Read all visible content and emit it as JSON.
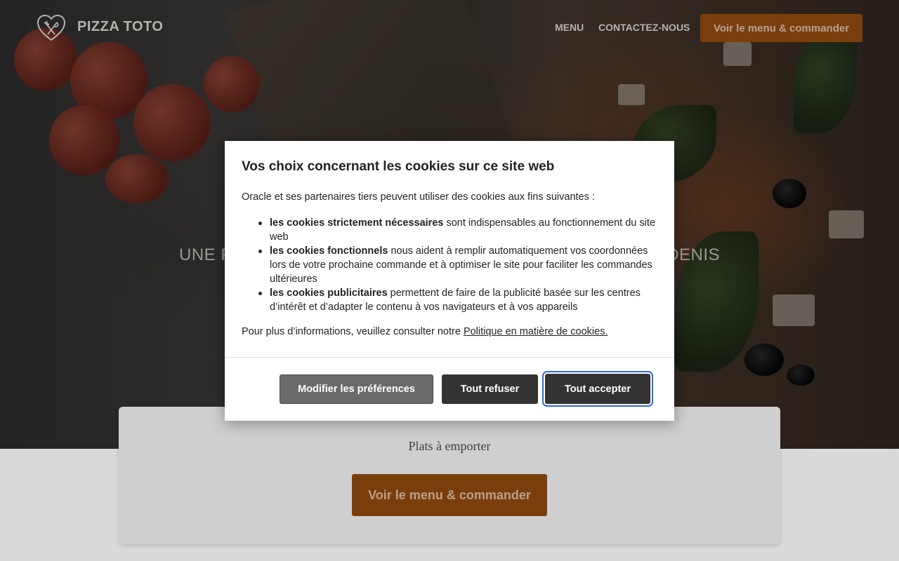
{
  "brand": {
    "name": "PIZZA TOTO",
    "logo_icon": "fork-knife-heart-icon"
  },
  "nav": {
    "items": [
      {
        "label": "MENU"
      },
      {
        "label": "CONTACTEZ-NOUS"
      }
    ],
    "cta_label": "Voir le menu & commander"
  },
  "hero": {
    "tagline_left": "UNE P",
    "tagline_right": "DENIS"
  },
  "card": {
    "title": "Plats à emporter",
    "cta_label": "Voir le menu & commander"
  },
  "cookie_modal": {
    "title": "Vos choix concernant les cookies sur ce site web",
    "intro": "Oracle et ses partenaires tiers peuvent utiliser des cookies aux fins suivantes :",
    "items": [
      {
        "strong": "les cookies strictement nécessaires",
        "text": " sont indispensables au fonctionnement du site web"
      },
      {
        "strong": "les cookies fonctionnels",
        "text": " nous aident à remplir automatiquement vos coordonnées lors de votre prochaine commande et à optimiser le site pour faciliter les commandes ultérieures"
      },
      {
        "strong": "les cookies publicitaires",
        "text": " permettent de faire de la publicité basée sur les centres d’intérêt et d’adapter le contenu à vos navigateurs et à vos appareils"
      }
    ],
    "more_prefix": "Pour plus d’informations, veuillez consulter notre ",
    "more_link": "Politique en matière de cookies.",
    "buttons": {
      "preferences": "Modifier les préférences",
      "refuse": "Tout refuser",
      "accept": "Tout accepter"
    }
  },
  "colors": {
    "accent": "#7a3e0d",
    "button_dark": "#333333",
    "button_gray": "#6a6a6a",
    "focus_ring": "#2f6ad9"
  }
}
